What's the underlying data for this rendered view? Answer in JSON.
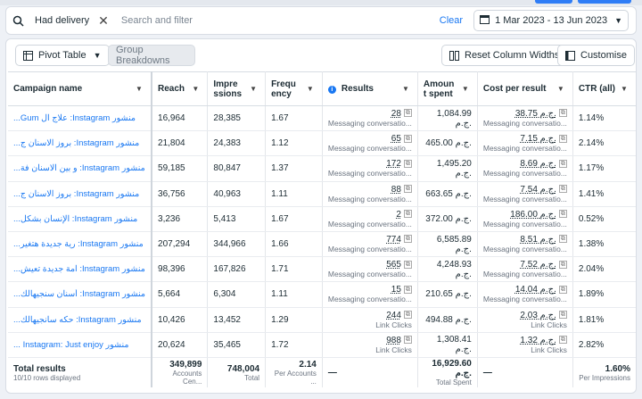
{
  "filter": {
    "chip_label": "Had delivery",
    "search_placeholder": "Search and filter",
    "clear_label": "Clear",
    "date_range": "1 Mar 2023 - 13 Jun 2023"
  },
  "toolbar": {
    "pivot_label": "Pivot Table",
    "group_label": "Group Breakdowns",
    "reset_label": "Reset Column Widths",
    "customise_label": "Customise"
  },
  "columns": {
    "campaign": "Campaign name",
    "reach": "Reach",
    "impressions": "Impre ssions",
    "frequency": "Frequ ency",
    "results": "Results",
    "amount": "Amoun t spent",
    "cpr": "Cost per result",
    "ctr": "CTR (all)"
  },
  "rows": [
    {
      "campaign": "منشور Instagram: علاج ال Gum...",
      "reach": "16,964",
      "impressions": "28,385",
      "frequency": "1.67",
      "results": "28",
      "results_sub": "Messaging conversatio...",
      "amount": "1,084.99 ج.م.",
      "cpr": "38.75 ج.م.",
      "cpr_sub": "Messaging conversatio...",
      "ctr": "1.14%"
    },
    {
      "campaign": "منشور Instagram: بروز الاسنان ج...",
      "reach": "21,804",
      "impressions": "24,383",
      "frequency": "1.12",
      "results": "65",
      "results_sub": "Messaging conversatio...",
      "amount": "465.00 ج.م.",
      "cpr": "7.15 ج.م.",
      "cpr_sub": "Messaging conversatio...",
      "ctr": "2.14%"
    },
    {
      "campaign": "منشور Instagram: و بين الاسنان فة...",
      "reach": "59,185",
      "impressions": "80,847",
      "frequency": "1.37",
      "results": "172",
      "results_sub": "Messaging conversatio...",
      "amount": "1,495.20 ج.م.",
      "cpr": "8.69 ج.م.",
      "cpr_sub": "Messaging conversatio...",
      "ctr": "1.17%"
    },
    {
      "campaign": "منشور Instagram: بروز الاسنان ج...",
      "reach": "36,756",
      "impressions": "40,963",
      "frequency": "1.11",
      "results": "88",
      "results_sub": "Messaging conversatio...",
      "amount": "663.65 ج.م.",
      "cpr": "7.54 ج.م.",
      "cpr_sub": "Messaging conversatio...",
      "ctr": "1.41%"
    },
    {
      "campaign": "منشور Instagram: الإنسان بشكل...",
      "reach": "3,236",
      "impressions": "5,413",
      "frequency": "1.67",
      "results": "2",
      "results_sub": "Messaging conversatio...",
      "amount": "372.00 ج.م.",
      "cpr": "186.00 ج.م.",
      "cpr_sub": "Messaging conversatio...",
      "ctr": "0.52%"
    },
    {
      "campaign": "منشور Instagram: رية جديدة هتغير...",
      "reach": "207,294",
      "impressions": "344,966",
      "frequency": "1.66",
      "results": "774",
      "results_sub": "Messaging conversatio...",
      "amount": "6,585.89 ج.م.",
      "cpr": "8.51 ج.م.",
      "cpr_sub": "Messaging conversatio...",
      "ctr": "1.38%"
    },
    {
      "campaign": "منشور Instagram: امة جديدة تعيش...",
      "reach": "98,396",
      "impressions": "167,826",
      "frequency": "1.71",
      "results": "565",
      "results_sub": "Messaging conversatio...",
      "amount": "4,248.93 ج.م.",
      "cpr": "7.52 ج.م.",
      "cpr_sub": "Messaging conversatio...",
      "ctr": "2.04%"
    },
    {
      "campaign": "منشور Instagram: أسنان سنجيهالك...",
      "reach": "5,664",
      "impressions": "6,304",
      "frequency": "1.11",
      "results": "15",
      "results_sub": "Messaging conversatio...",
      "amount": "210.65 ج.م.",
      "cpr": "14.04 ج.م.",
      "cpr_sub": "Messaging conversatio...",
      "ctr": "1.89%"
    },
    {
      "campaign": "منشور Instagram: حكه سانجيهالك...",
      "reach": "10,426",
      "impressions": "13,452",
      "frequency": "1.29",
      "results": "244",
      "results_sub": "Link Clicks",
      "amount": "494.88 ج.م.",
      "cpr": "2.03 ج.م.",
      "cpr_sub": "Link Clicks",
      "ctr": "1.81%"
    },
    {
      "campaign": "منشور Instagram: Just enjoy ...",
      "reach": "20,624",
      "impressions": "35,465",
      "frequency": "1.72",
      "results": "988",
      "results_sub": "Link Clicks",
      "amount": "1,308.41 ج.م.",
      "cpr": "1.32 ج.م.",
      "cpr_sub": "Link Clicks",
      "ctr": "2.82%"
    }
  ],
  "totals": {
    "label": "Total results",
    "rows_label": "10/10 rows displayed",
    "reach": "349,899",
    "reach_sub": "Accounts Cen...",
    "impressions": "748,004",
    "impressions_sub": "Total",
    "frequency": "2.14",
    "frequency_sub": "Per Accounts ...",
    "results": "—",
    "amount": "16,929.60 ج.م.",
    "amount_sub": "Total Spent",
    "cpr": "—",
    "ctr": "1.60%",
    "ctr_sub": "Per Impressions"
  },
  "colors": {
    "accent": "#1877f2",
    "border": "#d8dde4"
  }
}
